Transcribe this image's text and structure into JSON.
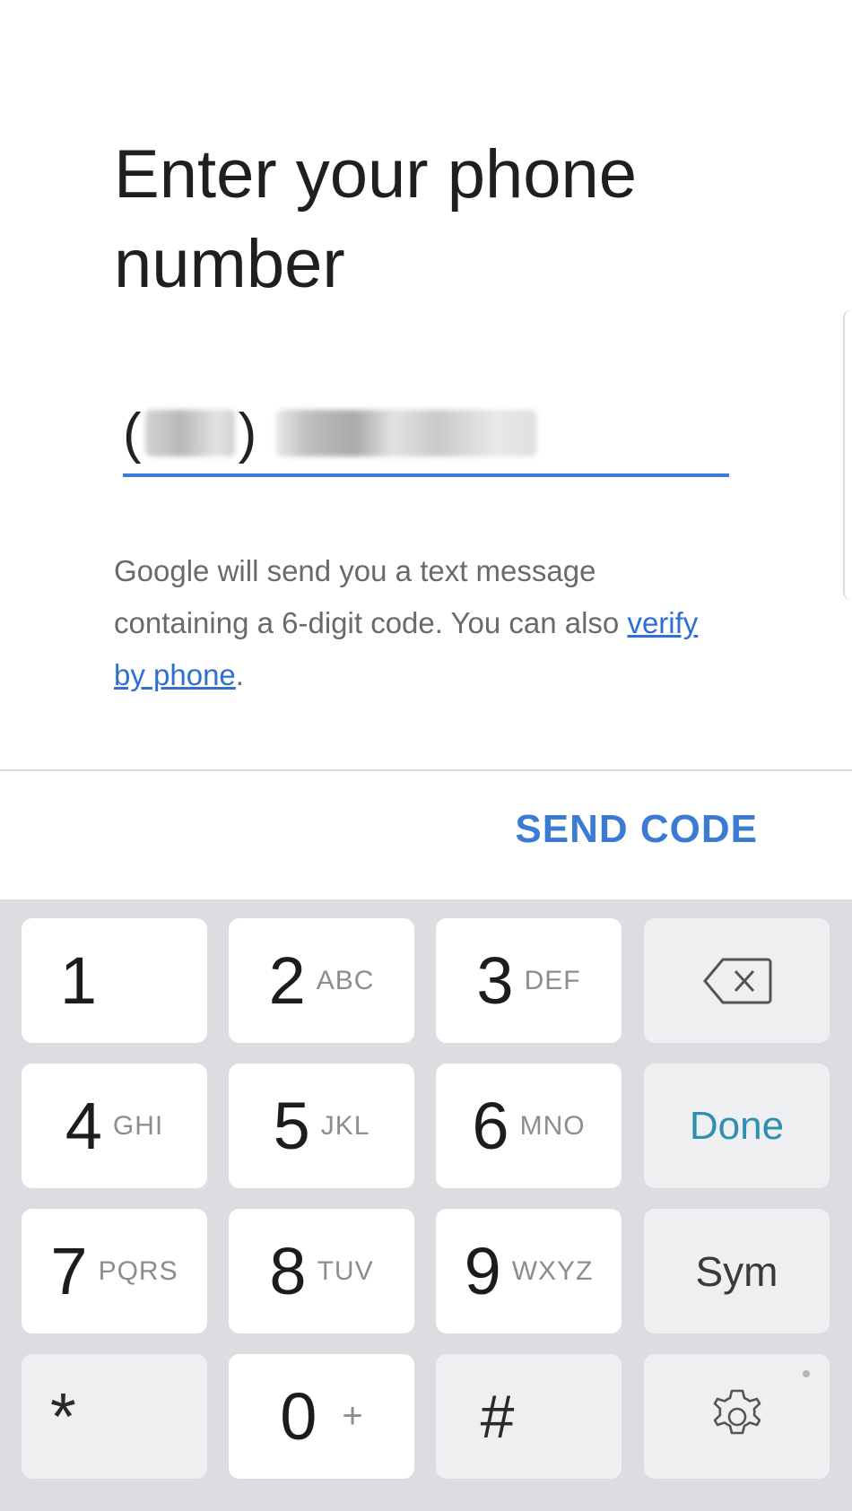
{
  "title": "Enter your phone number",
  "phone": {
    "open_paren": "(",
    "close_paren": ")"
  },
  "helper": {
    "text": "Google will send you a text message containing a 6-digit code. You can also ",
    "link": "verify by phone",
    "suffix": "."
  },
  "send_code_label": "SEND CODE",
  "colors": {
    "accent": "#3c7bd3",
    "underline": "#3d7bd6",
    "done": "#2f8fb1",
    "keyboard_bg": "#dcdde0"
  },
  "keyboard": {
    "keys": {
      "k1": {
        "digit": "1",
        "letters": ""
      },
      "k2": {
        "digit": "2",
        "letters": "ABC"
      },
      "k3": {
        "digit": "3",
        "letters": "DEF"
      },
      "k4": {
        "digit": "4",
        "letters": "GHI"
      },
      "k5": {
        "digit": "5",
        "letters": "JKL"
      },
      "k6": {
        "digit": "6",
        "letters": "MNO"
      },
      "k7": {
        "digit": "7",
        "letters": "PQRS"
      },
      "k8": {
        "digit": "8",
        "letters": "TUV"
      },
      "k9": {
        "digit": "9",
        "letters": "WXYZ"
      },
      "k0": {
        "digit": "0",
        "letters": "+"
      },
      "star": "*",
      "hash": "#"
    },
    "done_label": "Done",
    "sym_label": "Sym",
    "icons": {
      "backspace": "backspace-icon",
      "settings": "gear-icon"
    }
  }
}
